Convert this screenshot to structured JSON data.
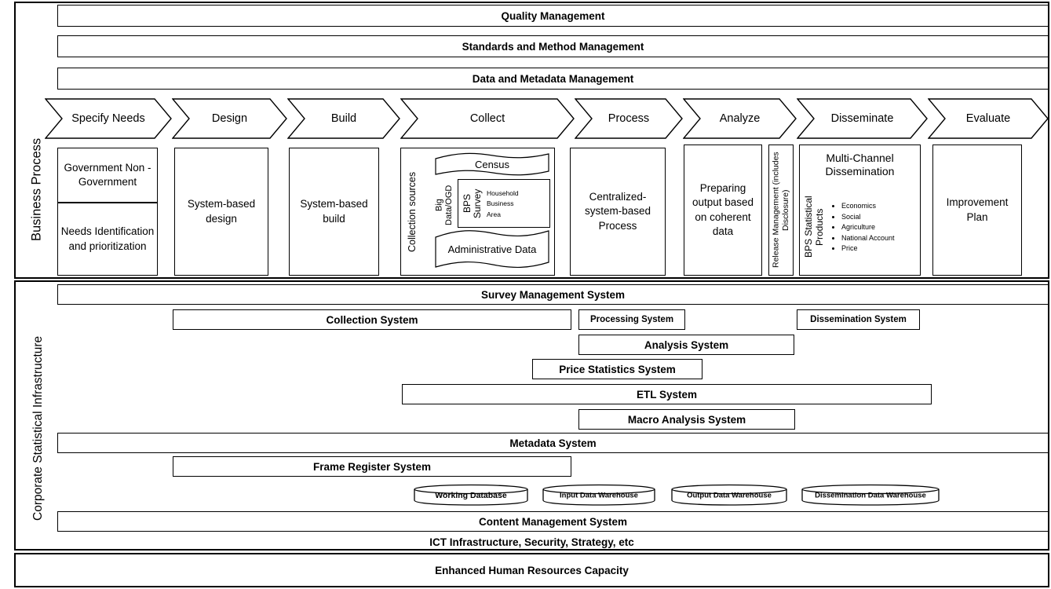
{
  "sections": {
    "business_process_label": "Business Process",
    "infrastructure_label": "Corporate Statistical Infrastructure"
  },
  "overarching_bars": [
    {
      "label": "Quality Management"
    },
    {
      "label": "Standards and Method Management"
    },
    {
      "label": "Data and Metadata Management"
    }
  ],
  "process_phases": [
    {
      "label": "Specify Needs"
    },
    {
      "label": "Design"
    },
    {
      "label": "Build"
    },
    {
      "label": "Collect"
    },
    {
      "label": "Process"
    },
    {
      "label": "Analyze"
    },
    {
      "label": "Disseminate"
    },
    {
      "label": "Evaluate"
    }
  ],
  "phase_details": {
    "specify_needs": [
      {
        "label": "Government Non - Government"
      },
      {
        "label": "Needs Identification and prioritization"
      }
    ],
    "design": {
      "label": "System-based design"
    },
    "build": {
      "label": "System-based build"
    },
    "collect": {
      "side_label": "Collection sources",
      "census": "Census",
      "big_data": "Big Data/OGD",
      "bps_survey": "BPS Survey",
      "survey_types": [
        "Household",
        "Business",
        "Area"
      ],
      "administrative_data": "Administrative Data"
    },
    "process": {
      "label": "Centralized-system-based Process"
    },
    "analyze": {
      "label": "Preparing output based on coherent data"
    },
    "release_management": {
      "label": "Release Management (includes Disclosure)"
    },
    "disseminate": {
      "title": "Multi-Channel Dissemination",
      "side_label": "BPS Statistical Products",
      "products": [
        "Economics",
        "Social",
        "Agriculture",
        "National Account",
        "Price"
      ]
    },
    "evaluate": {
      "label": "Improvement Plan"
    }
  },
  "infrastructure_systems": [
    {
      "label": "Survey Management System"
    },
    {
      "label": "Collection System"
    },
    {
      "label": "Processing System"
    },
    {
      "label": "Dissemination System"
    },
    {
      "label": "Analysis System"
    },
    {
      "label": "Price Statistics System"
    },
    {
      "label": "ETL System"
    },
    {
      "label": "Macro Analysis System"
    },
    {
      "label": "Metadata System"
    },
    {
      "label": "Frame Register System"
    }
  ],
  "databases": [
    {
      "label": "Working Database"
    },
    {
      "label": "Input Data Warehouse"
    },
    {
      "label": "Output Data Warehouse"
    },
    {
      "label": "Dissemination Data Warehouse"
    }
  ],
  "foundation_bars": [
    {
      "label": "Content Management System"
    },
    {
      "label": "ICT Infrastructure, Security, Strategy, etc"
    },
    {
      "label": "Enhanced Human Resources Capacity"
    }
  ],
  "colors": {
    "stroke": "#000000",
    "background": "#ffffff"
  }
}
